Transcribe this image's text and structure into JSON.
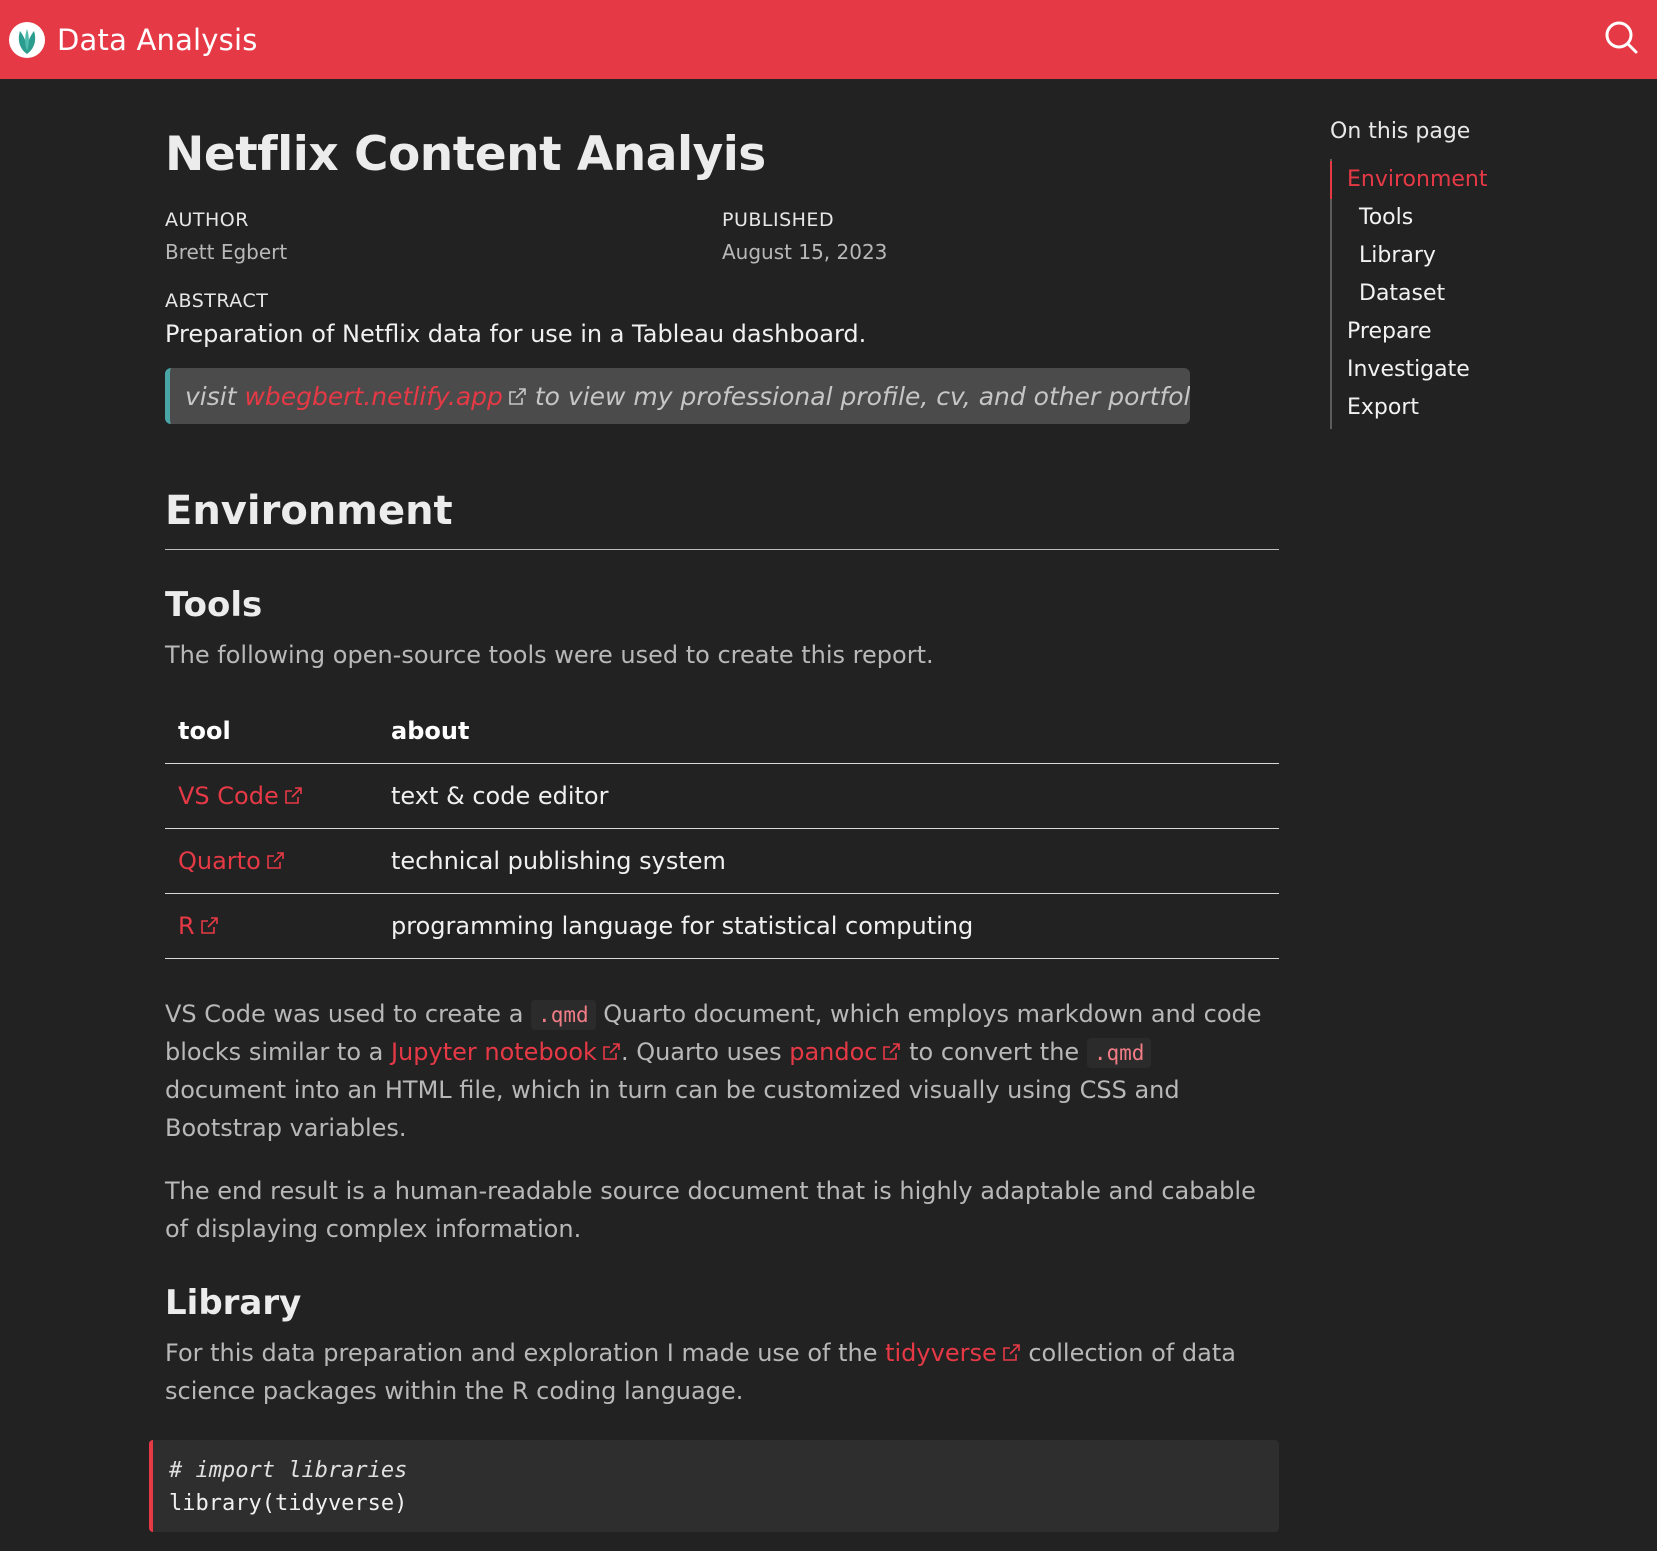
{
  "navbar": {
    "title": "Data Analysis",
    "logo_icon": "leaf-logo-icon",
    "search_icon": "search-icon",
    "background_color": "#e63946"
  },
  "article": {
    "title": "Netflix Content Analyis",
    "author_label": "AUTHOR",
    "author": "Brett Egbert",
    "published_label": "PUBLISHED",
    "published": "August 15, 2023",
    "abstract_label": "ABSTRACT",
    "abstract": "Preparation of Netflix data for use in a Tableau dashboard."
  },
  "callout": {
    "prefix": "visit ",
    "link": "wbegbert.netlify.app",
    "suffix": " to view my professional profile, cv, and other portfolio items",
    "accent_color": "#4aa6a6"
  },
  "environment": {
    "heading": "Environment",
    "tools": {
      "heading": "Tools",
      "intro": "The following open-source tools were used to create this report.",
      "table": {
        "headers": [
          "tool",
          "about"
        ],
        "rows": [
          {
            "tool": "VS Code",
            "about": "text & code editor"
          },
          {
            "tool": "Quarto",
            "about": "technical publishing system"
          },
          {
            "tool": "R",
            "about": "programming language for statistical computing"
          }
        ]
      },
      "para1": {
        "t1": "VS Code was used to create a ",
        "code1": ".qmd",
        "t2": " Quarto document, which employs markdown and code blocks similar to a ",
        "link1": "Jupyter notebook",
        "t3": ". Quarto uses ",
        "link2": "pandoc",
        "t4": " to convert the ",
        "code2": ".qmd",
        "t5": " document into an HTML file, which in turn can be customized visually using CSS and Bootstrap variables."
      },
      "para2": "The end result is a human-readable source document that is highly adaptable and cabable of displaying complex information."
    },
    "library": {
      "heading": "Library",
      "t1": "For this data preparation and exploration I made use of the ",
      "link": "tidyverse",
      "t2": " collection of data science packages within the R coding language.",
      "code_comment": "# import libraries",
      "code_line": "library(tidyverse)"
    }
  },
  "toc": {
    "title": "On this page",
    "items": [
      {
        "label": "Environment",
        "level": 1,
        "active": true
      },
      {
        "label": "Tools",
        "level": 2,
        "active": false
      },
      {
        "label": "Library",
        "level": 2,
        "active": false
      },
      {
        "label": "Dataset",
        "level": 2,
        "active": false
      },
      {
        "label": "Prepare",
        "level": 1,
        "active": false
      },
      {
        "label": "Investigate",
        "level": 1,
        "active": false
      },
      {
        "label": "Export",
        "level": 1,
        "active": false
      }
    ],
    "active_color": "#e63946"
  },
  "colors": {
    "background": "#222222",
    "link": "#e63946",
    "inline_code": "#f07c86"
  }
}
